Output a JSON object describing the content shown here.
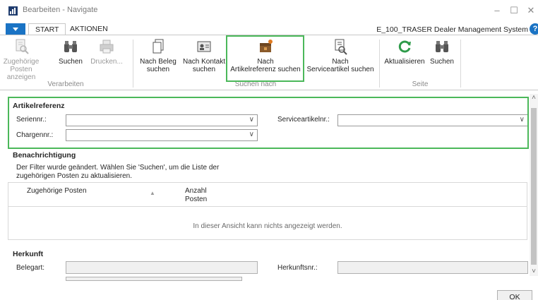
{
  "window": {
    "title": "Bearbeiten - Navigate"
  },
  "tabs": {
    "start": "START",
    "actions": "AKTIONEN"
  },
  "system_name": "E_100_TRASER Dealer Management System",
  "ribbon": {
    "groups": {
      "process": "Verarbeiten",
      "search_by": "Suchen nach",
      "page": "Seite"
    },
    "buttons": {
      "related_line1": "Zugehörige",
      "related_line2": "Posten anzeigen",
      "search": "Suchen",
      "print": "Drucken...",
      "by_doc_line1": "Nach Beleg",
      "by_doc_line2": "suchen",
      "by_contact_line1": "Nach Kontakt",
      "by_contact_line2": "suchen",
      "by_itemref_line1": "Nach",
      "by_itemref_line2": "Artikelreferenz suchen",
      "by_service_line1": "Nach",
      "by_service_line2": "Serviceartikel suchen",
      "refresh": "Aktualisieren",
      "search2": "Suchen"
    }
  },
  "item_reference": {
    "title": "Artikelreferenz",
    "serial_label": "Seriennr.:",
    "serial_value": "",
    "lot_label": "Chargennr.:",
    "lot_value": "",
    "service_item_label": "Serviceartikelnr.:",
    "service_item_value": ""
  },
  "notification": {
    "title": "Benachrichtigung",
    "message": "Der Filter wurde geändert. Wählen Sie 'Suchen', um die Liste der zugehörigen Posten zu aktualisieren."
  },
  "grid": {
    "col_related": "Zugehörige Posten",
    "col_count_line1": "Anzahl",
    "col_count_line2": "Posten",
    "empty_message": "In dieser Ansicht kann nichts angezeigt werden."
  },
  "origin": {
    "title": "Herkunft",
    "doc_type_label": "Belegart:",
    "origin_no_label": "Herkunftsnr.:"
  },
  "ok_label": "OK",
  "colors": {
    "accent": "#1a73c4",
    "highlight": "#4bb85a"
  }
}
